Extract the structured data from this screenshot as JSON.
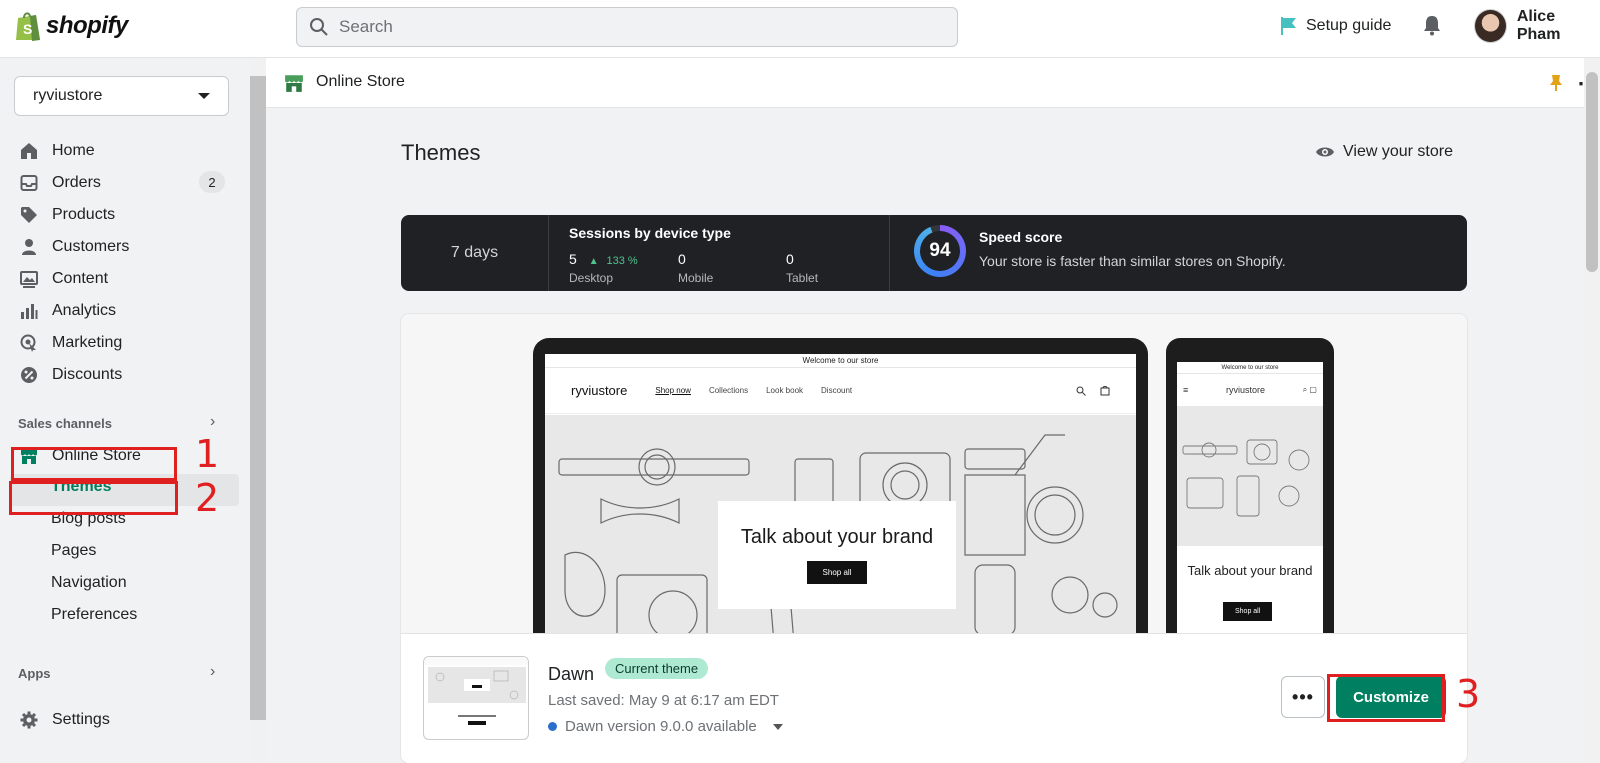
{
  "app": {
    "logo_text": "shopify",
    "search_placeholder": "Search",
    "setup_guide": "Setup guide",
    "user_name": "Alice Pham"
  },
  "sidebar": {
    "store_name": "ryviustore",
    "items": [
      {
        "label": "Home",
        "icon": "home-icon"
      },
      {
        "label": "Orders",
        "icon": "inbox-icon",
        "badge": "2"
      },
      {
        "label": "Products",
        "icon": "tag-icon"
      },
      {
        "label": "Customers",
        "icon": "person-icon"
      },
      {
        "label": "Content",
        "icon": "image-icon"
      },
      {
        "label": "Analytics",
        "icon": "bar-chart-icon"
      },
      {
        "label": "Marketing",
        "icon": "target-icon"
      },
      {
        "label": "Discounts",
        "icon": "discount-icon"
      }
    ],
    "sales_channels_label": "Sales channels",
    "online_store": "Online Store",
    "sub_items": [
      "Themes",
      "Blog posts",
      "Pages",
      "Navigation",
      "Preferences"
    ],
    "apps_label": "Apps",
    "settings": "Settings"
  },
  "annotations": [
    "1",
    "2",
    "3"
  ],
  "page_header": {
    "title": "Online Store"
  },
  "main": {
    "title": "Themes",
    "view_store": "View your store",
    "stats": {
      "period": "7 days",
      "sessions_title": "Sessions by device type",
      "desktop_value": "5",
      "desktop_change": "133 %",
      "desktop_label": "Desktop",
      "mobile_value": "0",
      "mobile_label": "Mobile",
      "tablet_value": "0",
      "tablet_label": "Tablet",
      "speed_score": "94",
      "speed_title": "Speed score",
      "speed_desc": "Your store is faster than similar stores on Shopify."
    },
    "preview": {
      "announcement": "Welcome to our store",
      "store_brand": "ryviustore",
      "nav": [
        "Shop now",
        "Collections",
        "Look book",
        "Discount"
      ],
      "hero_text": "Talk about your brand",
      "shop_all": "Shop all"
    },
    "theme": {
      "name": "Dawn",
      "badge": "Current theme",
      "last_saved": "Last saved: May 9 at 6:17 am EDT",
      "version": "Dawn version 9.0.0 available",
      "more_label": "•••",
      "customize": "Customize"
    }
  }
}
